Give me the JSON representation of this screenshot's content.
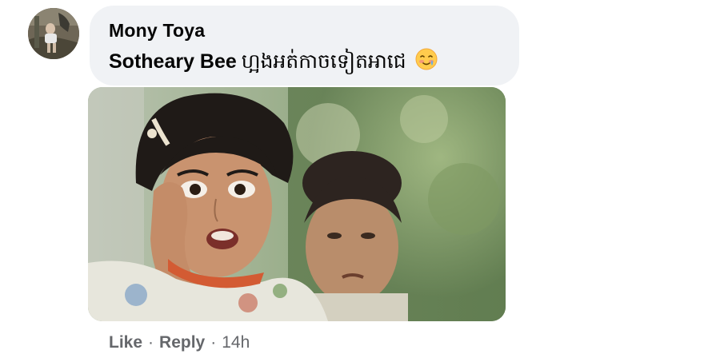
{
  "comment": {
    "author_name": "Mony Toya",
    "mention": "Sotheary Bee",
    "text": "ហ្អងអត់កាចទៀតអាជេ",
    "emoji": "smiling-face-with-tear-icon"
  },
  "media": {
    "type": "image",
    "description_icon": "gif-image"
  },
  "actions": {
    "like_label": "Like",
    "separator": "·",
    "reply_label": "Reply",
    "timestamp": "14h"
  },
  "colors": {
    "bubble_bg": "#f0f2f5",
    "meta_text": "#65676b",
    "primary_text": "#050505"
  }
}
